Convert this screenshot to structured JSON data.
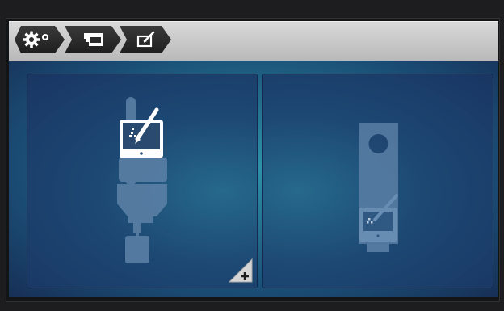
{
  "breadcrumb": {
    "items": [
      {
        "icon": "settings-icon"
      },
      {
        "icon": "sewing-machine-icon"
      },
      {
        "icon": "edit-screen-icon"
      }
    ]
  },
  "panels": [
    {
      "icon": "embroidery-unit-edit-icon",
      "state": "selected"
    },
    {
      "icon": "sewing-unit-edit-icon",
      "state": "unselected"
    }
  ],
  "colors": {
    "background_teal": "#2e93a8",
    "background_navy": "#172f56",
    "topbar": "#c8c8c8",
    "crumb": "#2a2a2a"
  }
}
